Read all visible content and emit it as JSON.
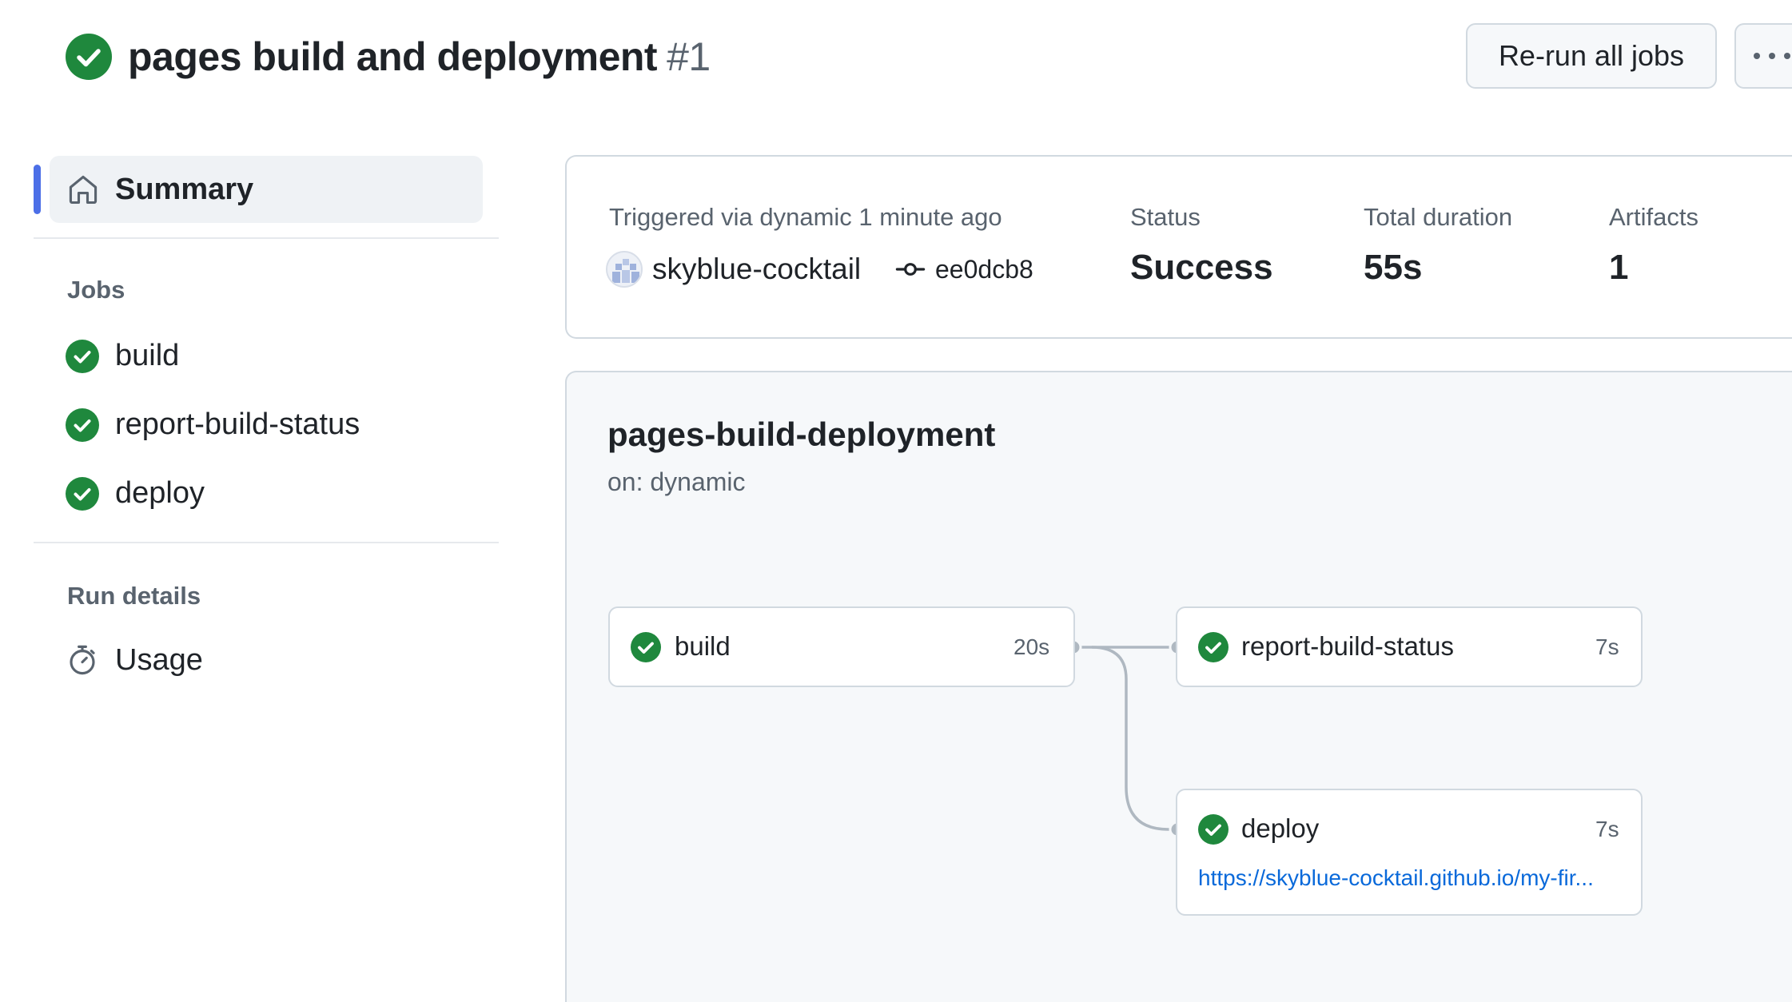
{
  "header": {
    "title": "pages build and deployment",
    "run_number": "#1",
    "rerun_label": "Re-run all jobs",
    "more_label": "···"
  },
  "sidebar": {
    "summary_label": "Summary",
    "jobs_heading": "Jobs",
    "jobs": [
      {
        "label": "build"
      },
      {
        "label": "report-build-status"
      },
      {
        "label": "deploy"
      }
    ],
    "run_details_heading": "Run details",
    "usage_label": "Usage"
  },
  "summary": {
    "trigger_text": "Triggered via dynamic 1 minute ago",
    "actor": "skyblue-cocktail",
    "commit": "ee0dcb8",
    "status_label": "Status",
    "status_value": "Success",
    "duration_label": "Total duration",
    "duration_value": "55s",
    "artifacts_label": "Artifacts",
    "artifacts_value": "1"
  },
  "workflow": {
    "name": "pages-build-deployment",
    "trigger": "on: dynamic",
    "jobs": {
      "build": {
        "name": "build",
        "duration": "20s"
      },
      "report": {
        "name": "report-build-status",
        "duration": "7s"
      },
      "deploy": {
        "name": "deploy",
        "duration": "7s",
        "url": "https://skyblue-cocktail.github.io/my-fir..."
      }
    }
  },
  "colors": {
    "success": "#1f883d",
    "accent": "#4c6fe7",
    "link": "#0969da",
    "muted": "#59636e"
  }
}
